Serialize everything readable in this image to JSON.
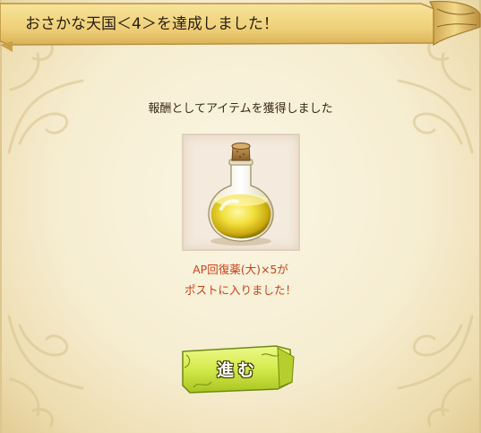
{
  "title": "おさかな天国＜4＞を達成しました！",
  "message": "報酬としてアイテムを獲得しました",
  "reward": {
    "line1": "AP回復薬(大)×5が",
    "line2": "ポストに入りました！",
    "icon": "yellow-potion-flask"
  },
  "next_button": {
    "label": "進む"
  },
  "colors": {
    "reward_text": "#c9431a",
    "banner": "#f0d27a",
    "button": "#d6ee58"
  }
}
